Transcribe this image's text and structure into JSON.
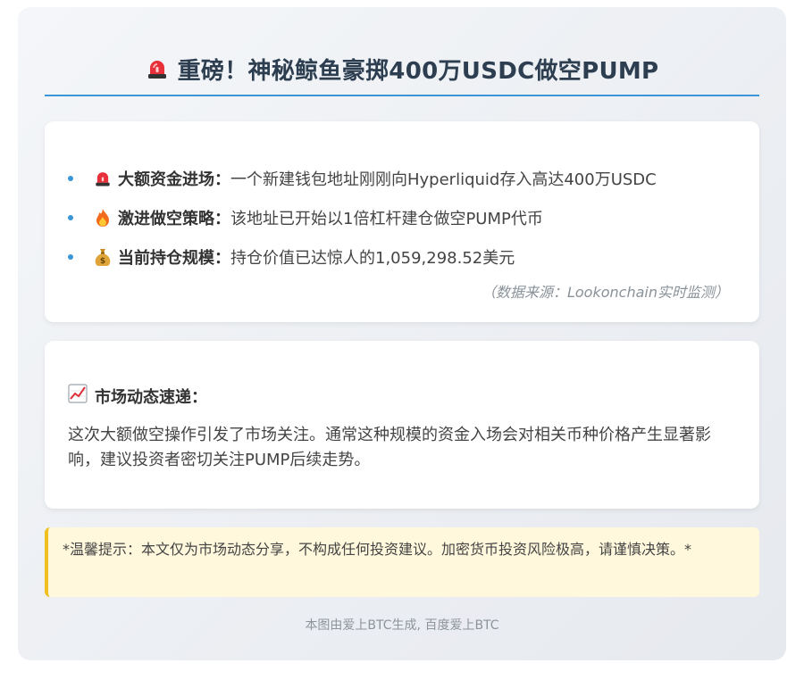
{
  "header": {
    "title": "重磅！神秘鲸鱼豪掷400万USDC做空PUMP",
    "title_icon": "siren-icon"
  },
  "key_points": [
    {
      "icon": "siren-icon",
      "label": "大额资金进场：",
      "text": "一个新建钱包地址刚刚向Hyperliquid存入高达400万USDC"
    },
    {
      "icon": "fire-icon",
      "label": "激进做空策略：",
      "text": "该地址已开始以1倍杠杆建仓做空PUMP代币"
    },
    {
      "icon": "money-bag-icon",
      "label": "当前持仓规模：",
      "text": "持仓价值已达惊人的1,059,298.52美元"
    }
  ],
  "source_note": "（数据来源：Lookonchain实时监测）",
  "market_section": {
    "icon": "chart-increasing-icon",
    "heading": "市场动态速递：",
    "body": "这次大额做空操作引发了市场关注。通常这种规模的资金入场会对相关币种价格产生显著影响，建议投资者密切关注PUMP后续走势。"
  },
  "disclaimer": "*温馨提示：本文仅为市场动态分享，不构成任何投资建议。加密货币投资风险极高，请谨慎决策。*",
  "footer": "本图由爱上BTC生成, 百度爱上BTC",
  "colors": {
    "accent": "#3a96d6",
    "title_text": "#2c3e50",
    "notice_bg": "#fff8dc",
    "notice_border": "#f0c020"
  }
}
